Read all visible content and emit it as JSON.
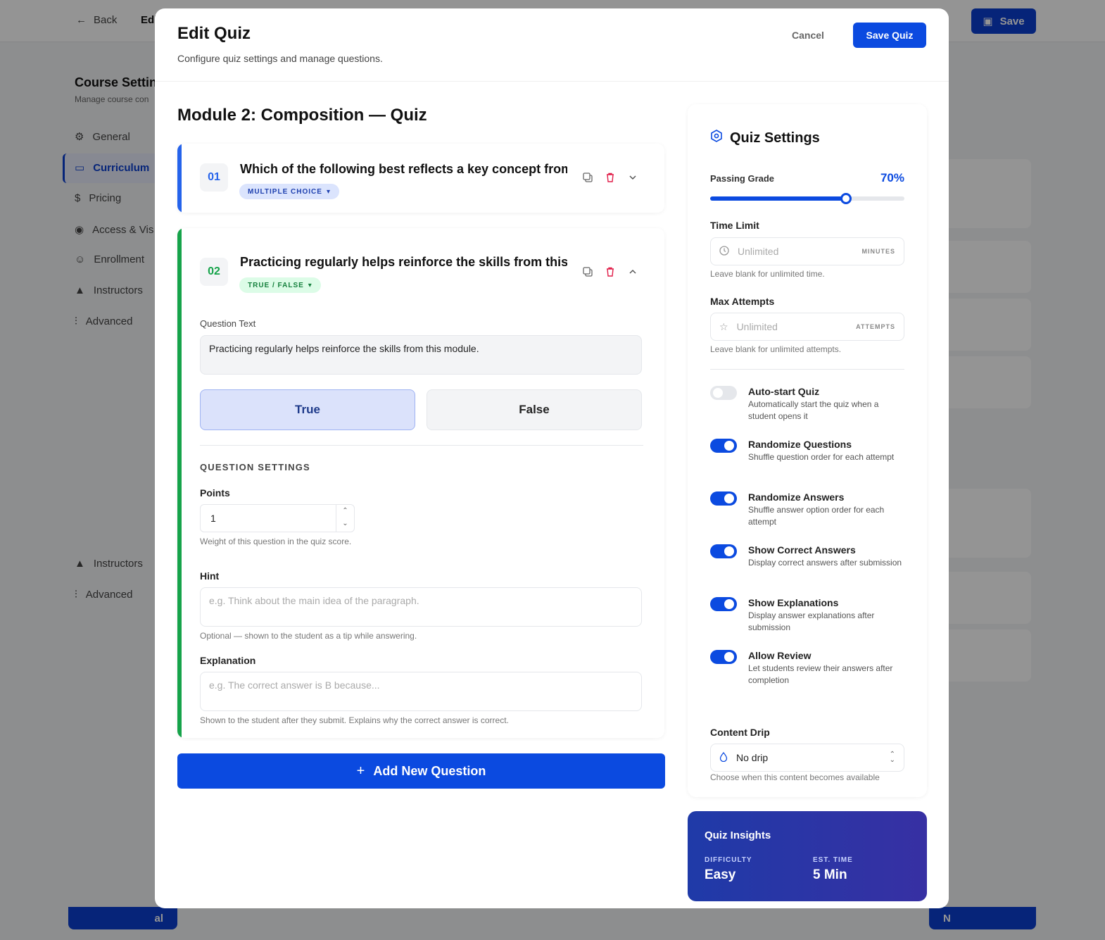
{
  "background": {
    "back_label": "Back",
    "edit_label": "Edi",
    "save_label": "Save",
    "sidebar_title": "Course Settin",
    "sidebar_subtitle": "Manage course con",
    "nav": [
      "General",
      "Curriculum",
      "Pricing",
      "Access & Vis",
      "Enrollment",
      "Instructors",
      "Advanced"
    ],
    "nav_lower": [
      "Instructors",
      "Advanced"
    ],
    "bottom_left_btn": "al",
    "bottom_right_btn": "N"
  },
  "modal": {
    "title": "Edit Quiz",
    "subtitle": "Configure quiz settings and manage questions.",
    "cancel_label": "Cancel",
    "save_label": "Save Quiz"
  },
  "quiz": {
    "title": "Module 2: Composition — Quiz",
    "questions": [
      {
        "number": "01",
        "text": "Which of the following best reflects a key concept from",
        "type": "MULTIPLE CHOICE"
      },
      {
        "number": "02",
        "text": "Practicing regularly helps reinforce the skills from this",
        "type": "TRUE / FALSE",
        "question_text_label": "Question Text",
        "question_text_value": "Practicing regularly helps reinforce the skills from this module.",
        "true_label": "True",
        "false_label": "False",
        "settings_heading": "QUESTION SETTINGS",
        "points_label": "Points",
        "points_value": "1",
        "points_help": "Weight of this question in the quiz score.",
        "hint_label": "Hint",
        "hint_placeholder": "e.g. Think about the main idea of the paragraph.",
        "hint_help": "Optional — shown to the student as a tip while answering.",
        "explanation_label": "Explanation",
        "explanation_placeholder": "e.g. The correct answer is B because...",
        "explanation_help": "Shown to the student after they submit. Explains why the correct answer is correct."
      }
    ],
    "add_question_label": "Add New Question"
  },
  "settings": {
    "title": "Quiz Settings",
    "passing_grade_label": "Passing Grade",
    "passing_grade_value": "70%",
    "passing_grade_fraction": 0.7,
    "time_limit_label": "Time Limit",
    "time_limit_placeholder": "Unlimited",
    "time_limit_unit": "MINUTES",
    "time_limit_help": "Leave blank for unlimited time.",
    "max_attempts_label": "Max Attempts",
    "max_attempts_placeholder": "Unlimited",
    "max_attempts_unit": "ATTEMPTS",
    "max_attempts_help": "Leave blank for unlimited attempts.",
    "toggles": [
      {
        "title": "Auto-start Quiz",
        "desc": "Automatically start the quiz when a student opens it",
        "on": false
      },
      {
        "title": "Randomize Questions",
        "desc": "Shuffle question order for each attempt",
        "on": true
      },
      {
        "title": "Randomize Answers",
        "desc": "Shuffle answer option order for each attempt",
        "on": true
      },
      {
        "title": "Show Correct Answers",
        "desc": "Display correct answers after submission",
        "on": true
      },
      {
        "title": "Show Explanations",
        "desc": "Display answer explanations after submission",
        "on": true
      },
      {
        "title": "Allow Review",
        "desc": "Let students review their answers after completion",
        "on": true
      }
    ],
    "content_drip_label": "Content Drip",
    "content_drip_value": "No drip",
    "content_drip_help": "Choose when this content becomes available"
  },
  "insights": {
    "title": "Quiz Insights",
    "difficulty_label": "DIFFICULTY",
    "difficulty_value": "Easy",
    "time_label": "EST. TIME",
    "time_value": "5 Min"
  },
  "colors": {
    "primary": "#0b4ae0",
    "accent_q1": "#2563eb",
    "accent_q2": "#16a34a",
    "danger": "#e11d48"
  }
}
